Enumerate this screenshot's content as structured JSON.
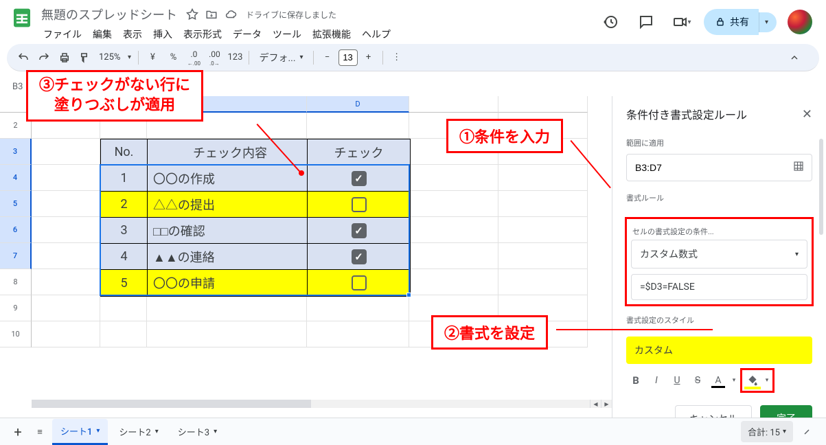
{
  "doc": {
    "title": "無題のスプレッドシート",
    "save_status": "ドライブに保存しました"
  },
  "menu": {
    "file": "ファイル",
    "edit": "編集",
    "view": "表示",
    "insert": "挿入",
    "format": "表示形式",
    "data": "データ",
    "tools": "ツール",
    "extensions": "拡張機能",
    "help": "ヘルプ"
  },
  "share": {
    "label": "共有"
  },
  "toolbar": {
    "zoom": "125%",
    "currency": "¥",
    "percent": "%",
    "dec_dec": ".0",
    "dec_inc": ".00",
    "font_name": "デフォ...",
    "font_size": "13"
  },
  "name_box": "B3",
  "columns": {
    "D": "D"
  },
  "rows": [
    "2",
    "3",
    "4",
    "5",
    "6",
    "7",
    "8",
    "9",
    "10"
  ],
  "table": {
    "headers": {
      "no": "No.",
      "content": "チェック内容",
      "check": "チェック"
    },
    "rows": [
      {
        "no": "1",
        "content": "〇〇の作成",
        "checked": true,
        "highlight": false
      },
      {
        "no": "2",
        "content": "△△の提出",
        "checked": false,
        "highlight": true
      },
      {
        "no": "3",
        "content": "□□の確認",
        "checked": true,
        "highlight": false
      },
      {
        "no": "4",
        "content": "▲▲の連絡",
        "checked": true,
        "highlight": false
      },
      {
        "no": "5",
        "content": "〇〇の申請",
        "checked": false,
        "highlight": true
      }
    ]
  },
  "callouts": {
    "c1": "①条件を入力",
    "c2": "②書式を設定",
    "c3a": "③チェックがない行に",
    "c3b": "塗りつぶしが適用"
  },
  "sidebar": {
    "title": "条件付き書式設定ルール",
    "range_label": "範囲に適用",
    "range_value": "B3:D7",
    "rules_label": "書式ルール",
    "condition_label": "セルの書式設定の条件...",
    "condition_value": "カスタム数式",
    "formula_value": "=$D3=FALSE",
    "style_label": "書式設定のスタイル",
    "style_preview": "カスタム",
    "cancel": "キャンセル",
    "done": "完了"
  },
  "footer": {
    "sheet1": "シート1",
    "sheet2": "シート2",
    "sheet3": "シート3",
    "sum": "合計: 15"
  }
}
